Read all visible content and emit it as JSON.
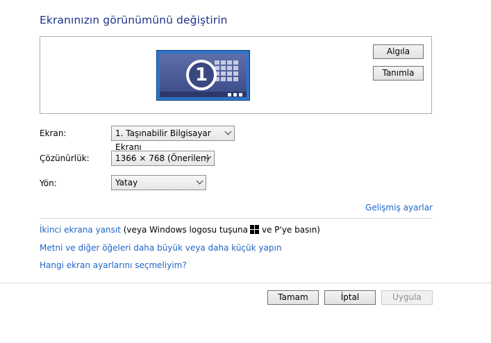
{
  "page": {
    "title": "Ekranınızın görünümünü değiştirin"
  },
  "preview": {
    "monitor_number": "1",
    "detect_label": "Algıla",
    "identify_label": "Tanımla"
  },
  "settings": {
    "display_label": "Ekran:",
    "display_value": "1. Taşınabilir Bilgisayar Ekranı",
    "resolution_label": "Çözünürlük:",
    "resolution_value": "1366 × 768 (Önerilen)",
    "orientation_label": "Yön:",
    "orientation_value": "Yatay"
  },
  "links": {
    "advanced": "Gelişmiş ayarlar",
    "project_link": "İkinci ekrana yansıt",
    "project_hint_prefix": " (veya Windows logosu tuşuna",
    "project_hint_suffix": "ve P'ye basın)",
    "text_size": "Metni ve diğer öğeleri daha büyük veya daha küçük yapın",
    "which_settings": "Hangi ekran ayarlarını seçmeliyim?"
  },
  "footer": {
    "ok_label": "Tamam",
    "cancel_label": "İptal",
    "apply_label": "Uygula"
  },
  "colors": {
    "title": "#1e3287",
    "link": "#1e64c8"
  }
}
